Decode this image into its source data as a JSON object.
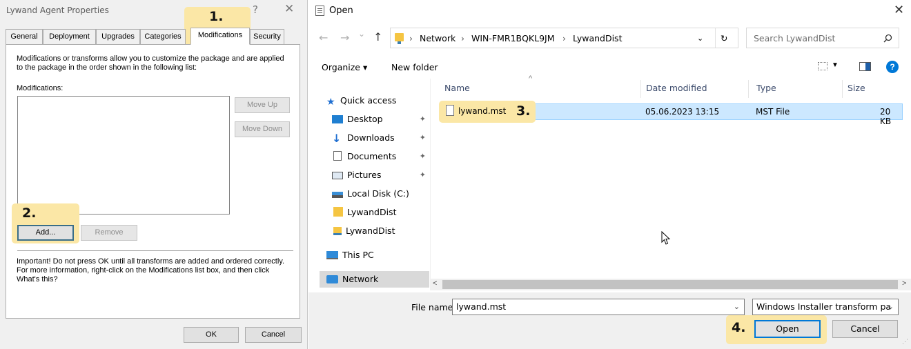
{
  "steps": {
    "s1": "1.",
    "s2": "2.",
    "s3": "3.",
    "s4": "4."
  },
  "properties_dialog": {
    "title": "Lywand Agent Properties",
    "help_label": "?",
    "close_label": "✕",
    "tabs": [
      "General",
      "Deployment",
      "Upgrades",
      "Categories",
      "Modifications",
      "Security"
    ],
    "active_tab": "Modifications",
    "description": "Modifications or transforms allow you to customize the package and are applied to the package in the order shown in the following list:",
    "list_label": "Modifications:",
    "move_up": "Move Up",
    "move_down": "Move Down",
    "add": "Add...",
    "remove": "Remove",
    "important": "Important! Do not press OK until all transforms are added and ordered correctly.  For more information, right-click on the Modifications list box, and then click What's this?",
    "ok": "OK",
    "cancel": "Cancel"
  },
  "open_dialog": {
    "title": "Open",
    "close_label": "✕",
    "nav": {
      "back": "←",
      "forward": "→",
      "recent": "⌄",
      "up": "↑",
      "refresh": "↻"
    },
    "breadcrumb": [
      "Network",
      "WIN-FMR1BQKL9JM",
      "LywandDist"
    ],
    "breadcrumb_sep": "›",
    "search_placeholder": "Search LywandDist",
    "organize": "Organize ▾",
    "new_folder": "New folder",
    "nav_items": [
      {
        "label": "Quick access",
        "icon": "star-icon"
      },
      {
        "label": "Desktop",
        "icon": "desktop-icon",
        "pinned": true
      },
      {
        "label": "Downloads",
        "icon": "download-icon",
        "pinned": true
      },
      {
        "label": "Documents",
        "icon": "documents-icon",
        "pinned": true
      },
      {
        "label": "Pictures",
        "icon": "pictures-icon",
        "pinned": true
      },
      {
        "label": "Local Disk (C:)",
        "icon": "disk-icon"
      },
      {
        "label": "LywandDist",
        "icon": "folder-icon"
      },
      {
        "label": "LywandDist",
        "icon": "network-share-icon"
      },
      {
        "label": "This PC",
        "icon": "pc-icon"
      },
      {
        "label": "Network",
        "icon": "network-icon"
      }
    ],
    "pin_glyph": "✦",
    "columns": {
      "name": "Name",
      "date": "Date modified",
      "type": "Type",
      "size": "Size"
    },
    "files": [
      {
        "name": "lywand.mst",
        "date": "05.06.2023 13:15",
        "type": "MST File",
        "size": "20 KB"
      }
    ],
    "file_name_label": "File name:",
    "file_name_value": "lywand.mst",
    "filter": "Windows Installer transform pa",
    "open": "Open",
    "cancel": "Cancel"
  },
  "colors": {
    "highlight": "#fbe7a6",
    "selection": "#cce8ff",
    "accent": "#0078d7"
  }
}
